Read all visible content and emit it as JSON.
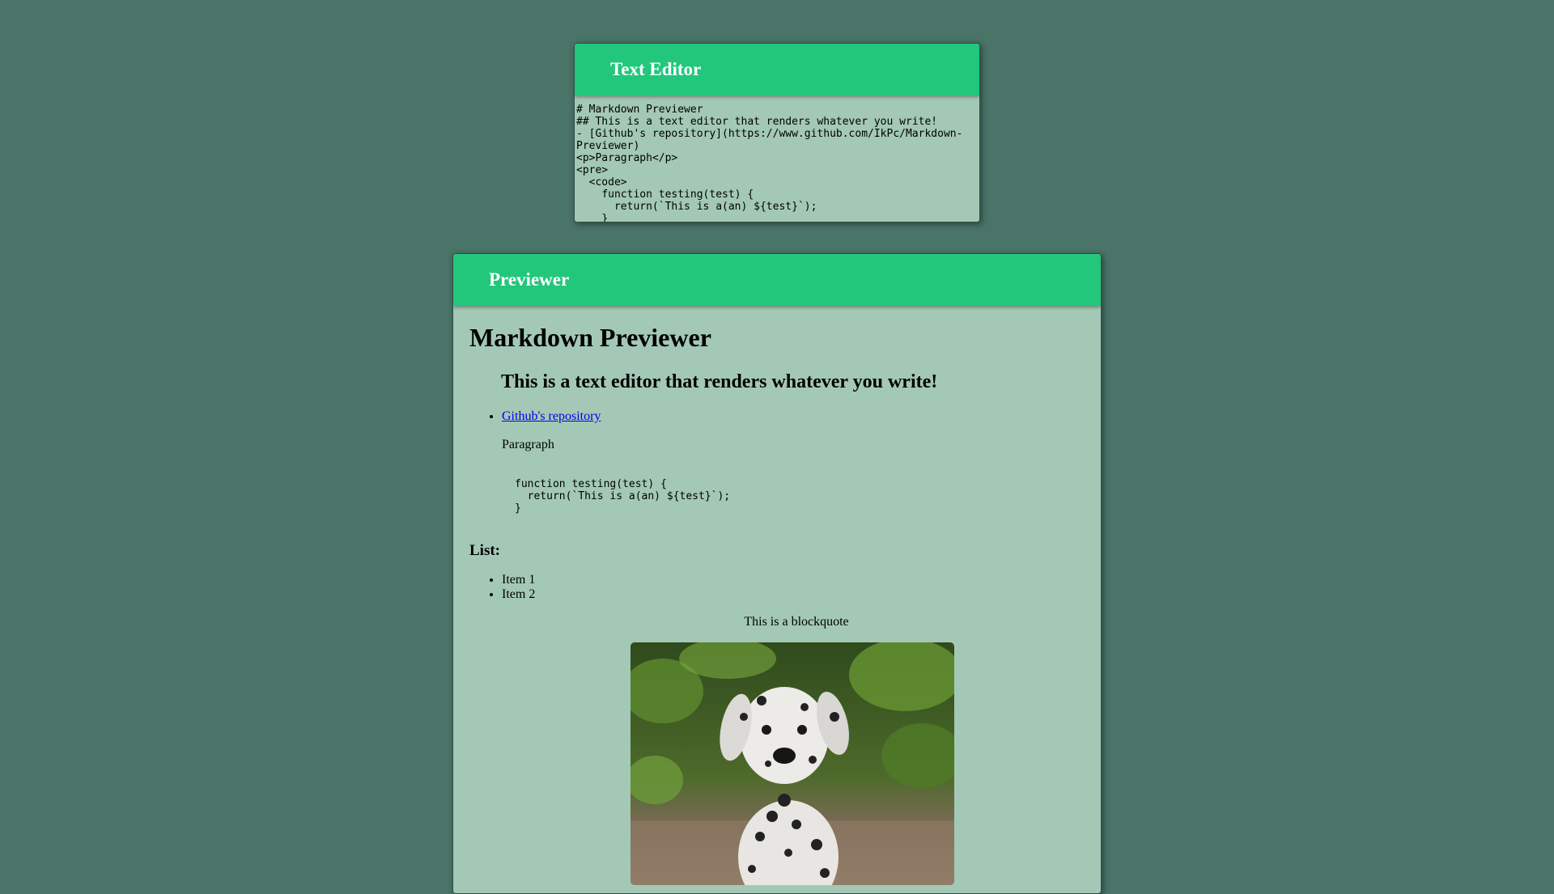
{
  "editor": {
    "title": "Text Editor",
    "content": "# Markdown Previewer\n## This is a text editor that renders whatever you write!\n- [Github's repository](https://www.github.com/IkPc/Markdown-Previewer)\n<p>Paragraph</p>\n<pre>\n  <code>\n    function testing(test) {\n      return(`This is a(an) ${test}`);\n    }"
  },
  "previewer": {
    "title": "Previewer",
    "h1": "Markdown Previewer",
    "h2": "This is a text editor that renders whatever you write!",
    "link_text": "Github's repository",
    "paragraph": "Paragraph",
    "code": "function testing(test) {\n  return(`This is a(an) ${test}`);\n}",
    "list_heading": "List:",
    "list_items": [
      "Item 1",
      "Item 2"
    ],
    "blockquote": "This is a blockquote"
  },
  "colors": {
    "background": "#4a7468",
    "panel": "#a3c9b6",
    "header": "#22c77c",
    "link": "#0000ee"
  }
}
